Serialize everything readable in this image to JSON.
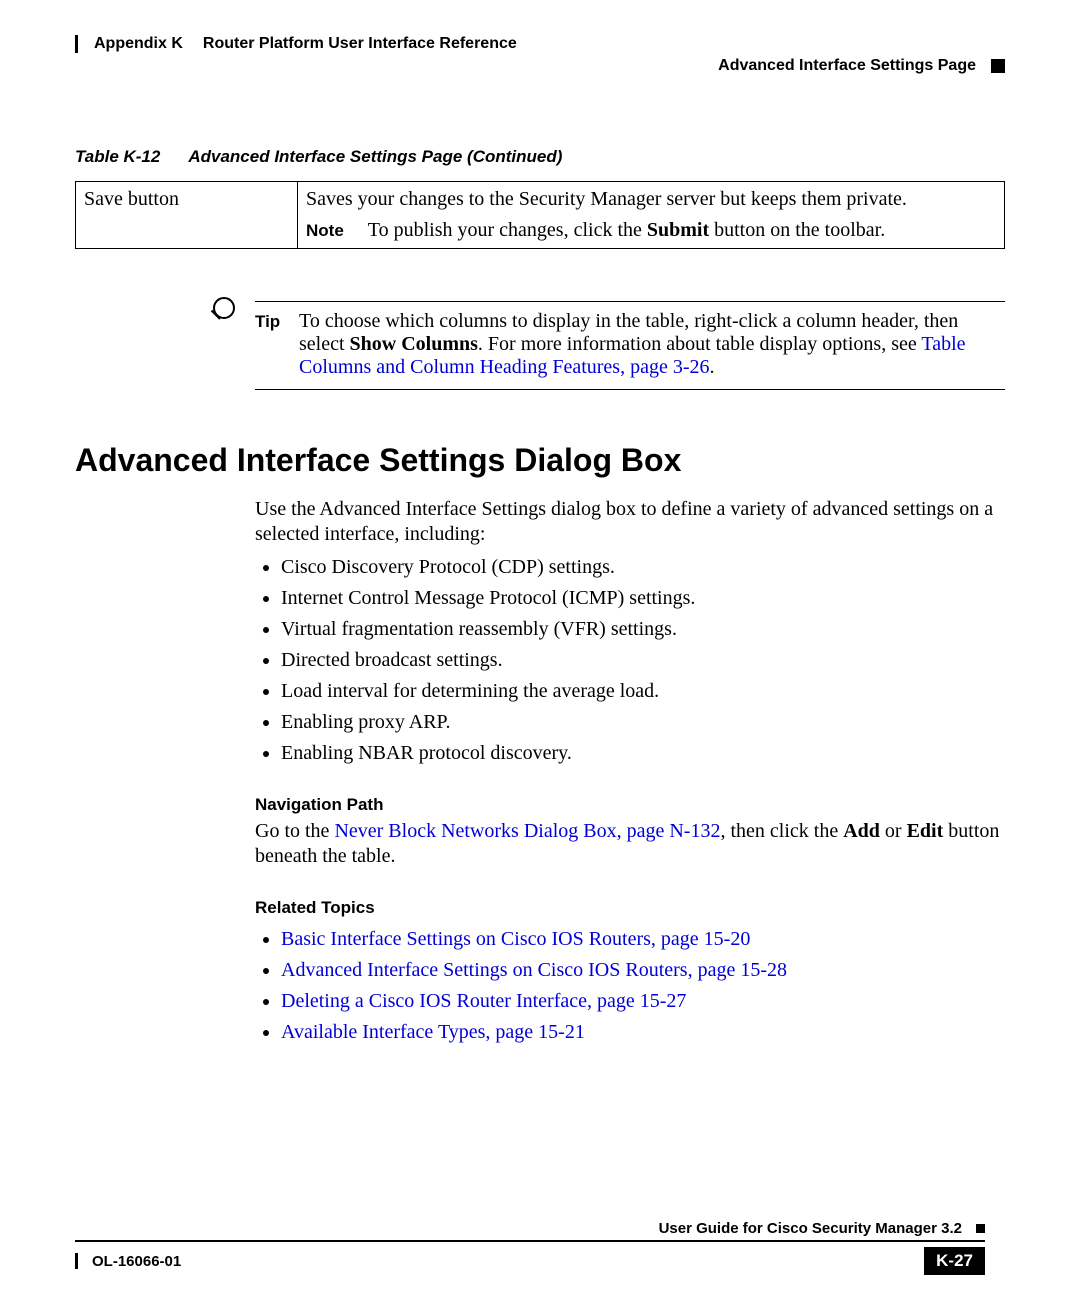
{
  "header": {
    "appendix": "Appendix K",
    "title": "Router Platform User Interface Reference",
    "subtitle": "Advanced Interface Settings Page"
  },
  "table": {
    "caption_num": "Table K-12",
    "caption_text": "Advanced Interface Settings Page (Continued)",
    "row": {
      "label": "Save button",
      "desc": "Saves your changes to the Security Manager server but keeps them private.",
      "note_label": "Note",
      "note_text_a": "To publish your changes, click the ",
      "note_bold": "Submit",
      "note_text_b": " button on the toolbar."
    }
  },
  "tip": {
    "label": "Tip",
    "text_a": "To choose which columns to display in the table, right-click a column header, then select ",
    "bold": "Show Columns",
    "text_b": ". For more information about table display options, see ",
    "link": "Table Columns and Column Heading Features, page 3-26",
    "text_c": "."
  },
  "section": {
    "heading": "Advanced Interface Settings Dialog Box",
    "intro": "Use the Advanced Interface Settings dialog box to define a variety of advanced settings on a selected interface, including:",
    "bullets": [
      "Cisco Discovery Protocol (CDP) settings.",
      "Internet Control Message Protocol (ICMP) settings.",
      "Virtual fragmentation reassembly (VFR) settings.",
      "Directed broadcast settings.",
      "Load interval for determining the average load.",
      "Enabling proxy ARP.",
      "Enabling NBAR protocol discovery."
    ],
    "nav": {
      "heading": "Navigation Path",
      "pre": "Go to the ",
      "link": "Never Block Networks Dialog Box, page N-132",
      "mid": ", then click the ",
      "b1": "Add",
      "or": " or ",
      "b2": "Edit",
      "post": " button beneath the table."
    },
    "related": {
      "heading": "Related Topics",
      "links": [
        "Basic Interface Settings on Cisco IOS Routers, page 15-20",
        "Advanced Interface Settings on Cisco IOS Routers, page 15-28",
        "Deleting a Cisco IOS Router Interface, page 15-27",
        "Available Interface Types, page 15-21"
      ]
    }
  },
  "footer": {
    "guide": "User Guide for Cisco Security Manager 3.2",
    "doc": "OL-16066-01",
    "page": "K-27"
  }
}
